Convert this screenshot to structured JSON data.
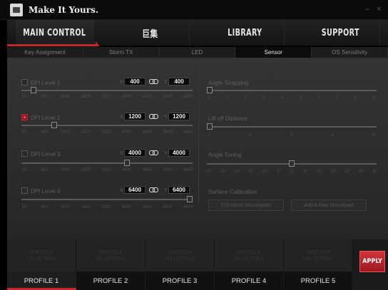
{
  "app": {
    "title": "Make It Yours.",
    "minimize": "–",
    "close": "×"
  },
  "main_nav": [
    "MAIN CONTROL",
    "巨集",
    "LIBRARY",
    "SUPPORT"
  ],
  "sub_nav": [
    "Key Assignment",
    "Storm TX",
    "LED",
    "Sensor",
    "OS Sensitivity"
  ],
  "sub_nav_active": 3,
  "dpi_ticks": [
    "50",
    "800",
    "1600",
    "2400",
    "3200",
    "4000",
    "4800",
    "5600",
    "6400"
  ],
  "dpi_levels": [
    {
      "label": "DPI Level 1",
      "checked": false,
      "x": "400",
      "y": "400",
      "value": 400
    },
    {
      "label": "DPI Level 2",
      "checked": true,
      "x": "1200",
      "y": "1200",
      "value": 1200
    },
    {
      "label": "DPI Level 3",
      "checked": false,
      "x": "4000",
      "y": "4000",
      "value": 4000
    },
    {
      "label": "DPI Level 4",
      "checked": false,
      "x": "6400",
      "y": "6400",
      "value": 6400
    }
  ],
  "xy": {
    "x": "X",
    "y": "Y"
  },
  "angle_snapping": {
    "label": "Angle Snapping",
    "ticks": [
      "0",
      "1",
      "2",
      "3",
      "4",
      "5",
      "6",
      "7",
      "8",
      "9"
    ],
    "value": 0
  },
  "lift_off": {
    "label": "Lift off Distance",
    "ticks": [
      "1",
      "2",
      "3",
      "4",
      "5"
    ],
    "value": 1
  },
  "angle_tuning": {
    "label": "Angle Tuning",
    "ticks": [
      "-30°",
      "-25°",
      "-20°",
      "-15°",
      "-10°",
      "-5°",
      "0°",
      "5°",
      "10°",
      "15°",
      "20°",
      "25°",
      "30°"
    ],
    "value": 0
  },
  "surface": {
    "label": "Surface Calibration",
    "btn1": "CM Storm Mousepads",
    "btn2": "Add A New Mousepad"
  },
  "profile_cells": [
    {
      "line1": "RIGHT CLICK",
      "line2": "145 x 82 PIXELS"
    },
    {
      "line1": "RIGHT CLICK",
      "line2": "145 x 82 PIXELS"
    },
    {
      "line1": "RIGHT CLICK",
      "line2": "145 x 82 PIXELS"
    },
    {
      "line1": "RIGHT CLICK",
      "line2": "145 x 82 PIXELS"
    },
    {
      "line1": "RIGHT CLICK",
      "line2": "145 x 82 PIXELS"
    }
  ],
  "profiles": [
    "PROFILE 1",
    "PROFILE 2",
    "PROFILE 3",
    "PROFILE 4",
    "PROFILE 5"
  ],
  "apply": "APPLY",
  "colors": {
    "accent": "#c4262e",
    "background": "#2d2d2d"
  }
}
